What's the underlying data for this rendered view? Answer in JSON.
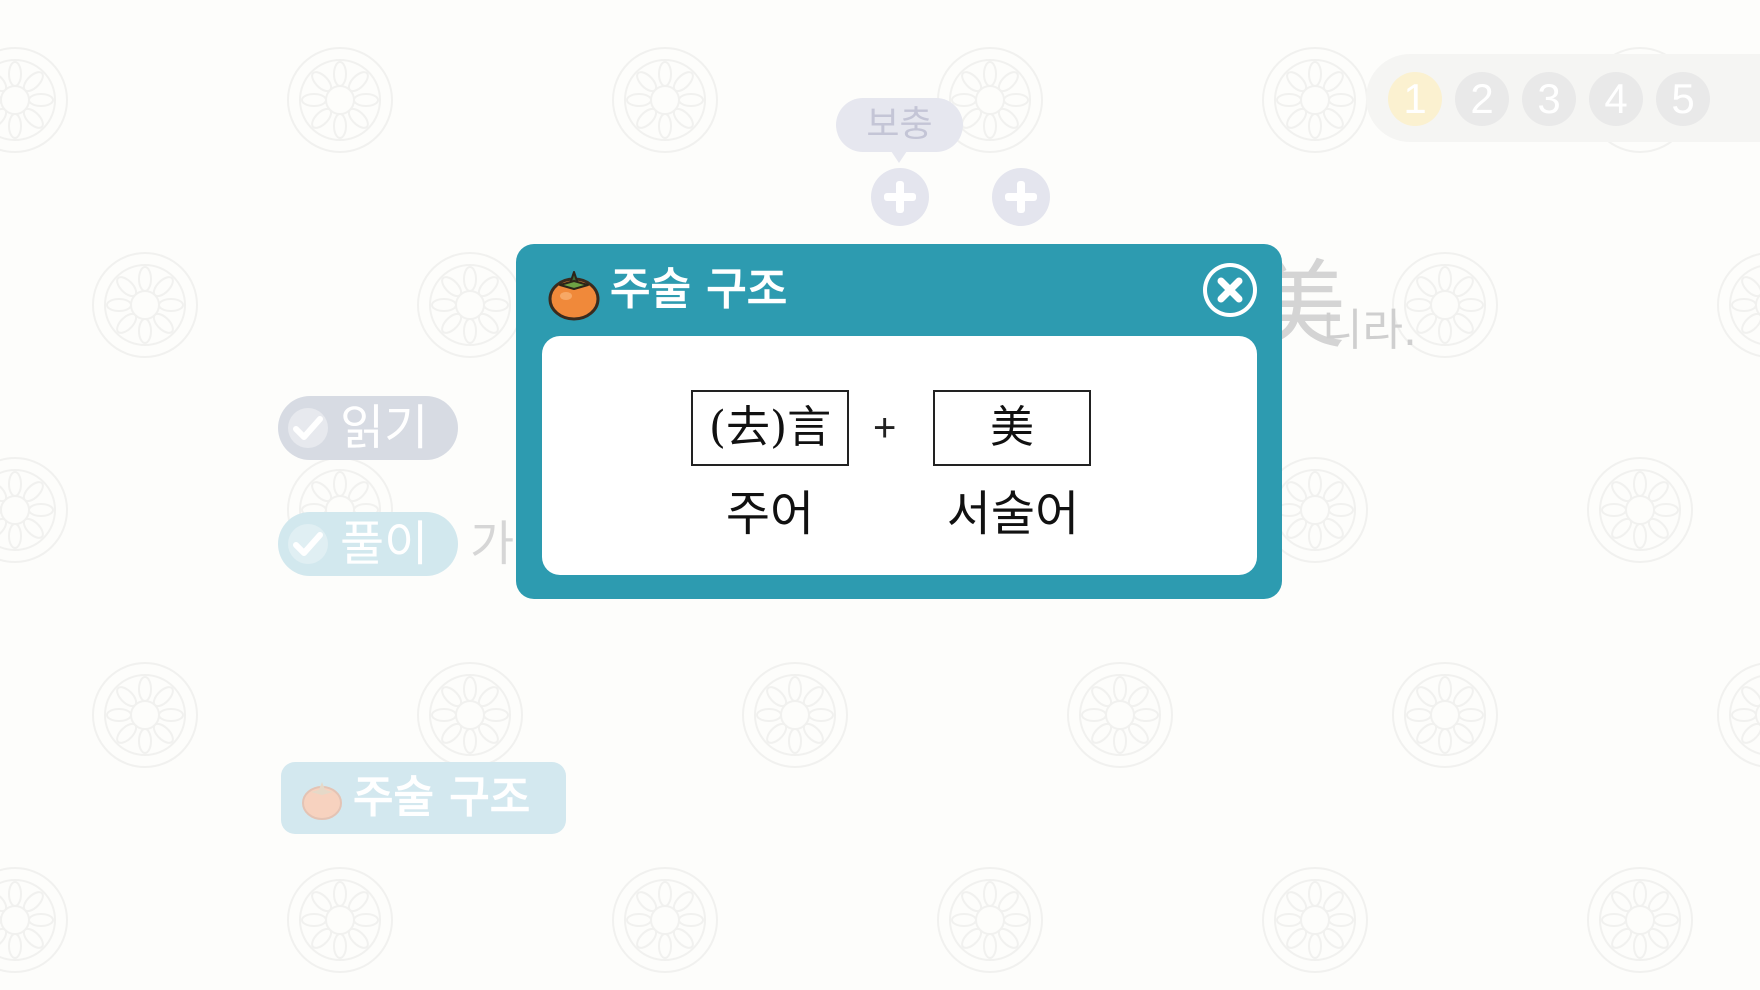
{
  "pagination": {
    "pages": [
      "1",
      "2",
      "3",
      "4",
      "5"
    ],
    "current": "1"
  },
  "supplement": {
    "label": "보충"
  },
  "sentence": {
    "hanja_fragment": "美",
    "ending": "니라.",
    "partial_left": "가"
  },
  "side_menu": {
    "read_label": "읽기",
    "solve_label": "풀이"
  },
  "bottom_button": {
    "label": "주술 구조"
  },
  "modal": {
    "title": "주술 구조",
    "subject_hanja": "(去)言",
    "operator": "+",
    "predicate_hanja": "美",
    "subject_label": "주어",
    "predicate_label": "서술어"
  },
  "colors": {
    "modal_accent": "#2d9bb0",
    "persimmon": "#f0893a"
  }
}
